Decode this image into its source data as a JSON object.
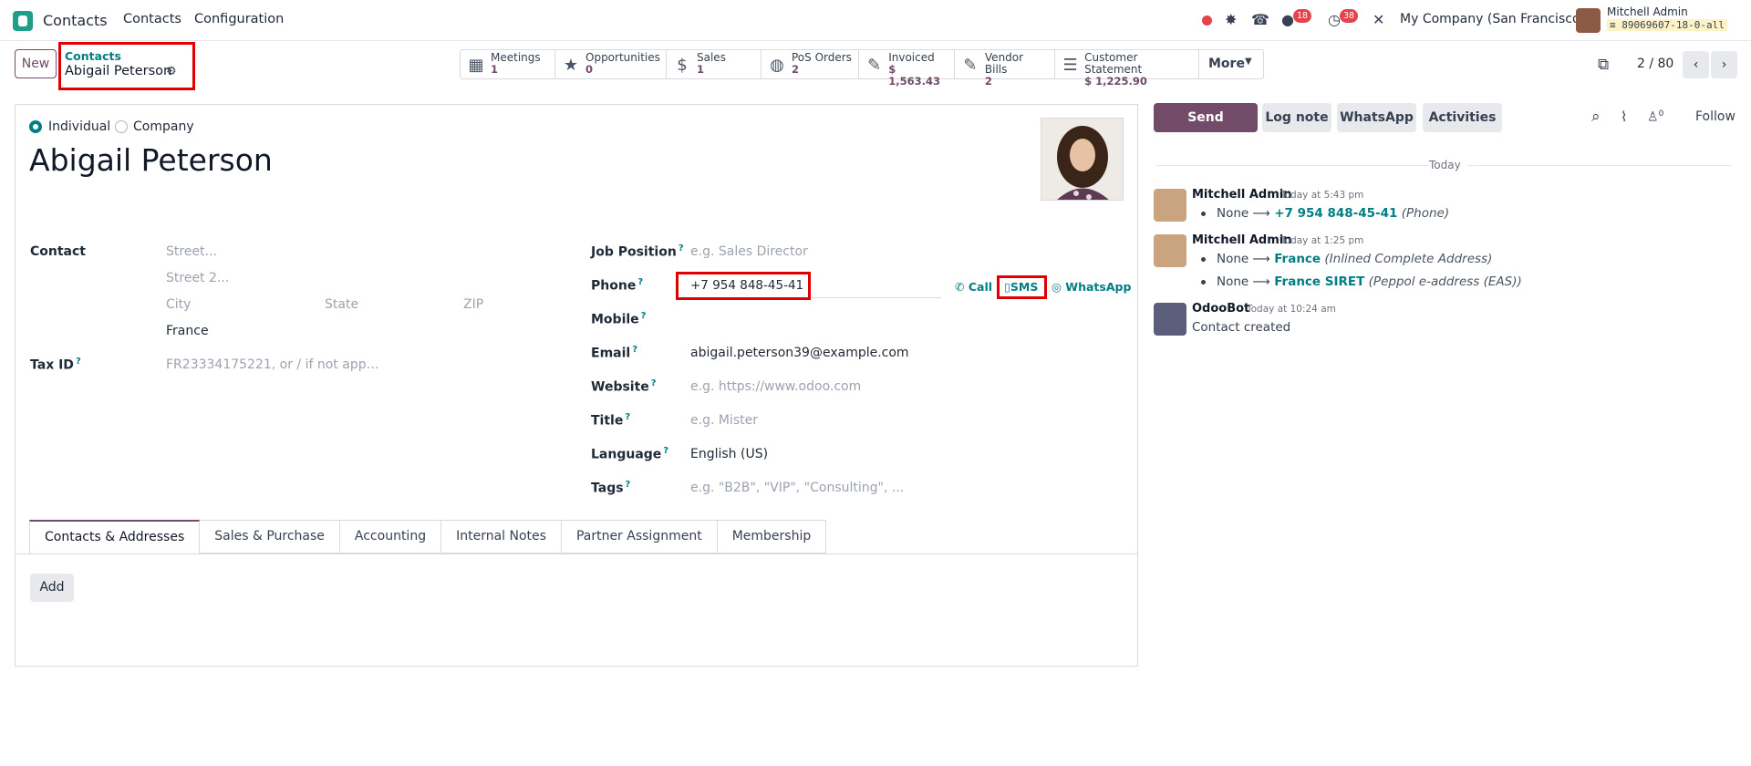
{
  "navbar": {
    "app_name": "Contacts",
    "menu": [
      "Contacts",
      "Configuration"
    ],
    "badges": {
      "messages": "18",
      "activities": "38"
    },
    "company": "My Company (San Francisco)",
    "user_name": "Mitchell Admin",
    "db_name": "89069607-18-0-all"
  },
  "control": {
    "new_label": "New",
    "breadcrumb_parent": "Contacts",
    "breadcrumb_current": "Abigail Peterson",
    "pager": "2 / 80",
    "smart_buttons": [
      {
        "label": "Meetings",
        "value": "1",
        "icon": "calendar-icon"
      },
      {
        "label": "Opportunities",
        "value": "0",
        "icon": "star-icon"
      },
      {
        "label": "Sales",
        "value": "1",
        "icon": "dollar-icon"
      },
      {
        "label": "PoS Orders",
        "value": "2",
        "icon": "shopping-bag-icon"
      },
      {
        "label": "Invoiced",
        "value": "$ 1,563.43",
        "icon": "pencil-square-icon"
      },
      {
        "label": "Vendor Bills",
        "value": "2",
        "icon": "pencil-square-icon"
      },
      {
        "label": "Customer Statement",
        "value": "$ 1,225.90",
        "icon": "list-icon"
      }
    ],
    "more_label": "More"
  },
  "form": {
    "type_individual": "Individual",
    "type_company": "Company",
    "name": "Abigail Peterson",
    "contact_label": "Contact",
    "street_ph": "Street...",
    "street2_ph": "Street 2...",
    "city_ph": "City",
    "state_ph": "State",
    "zip_ph": "ZIP",
    "country": "France",
    "taxid_label": "Tax ID",
    "taxid_ph": "FR23334175221, or / if not app…",
    "job_label": "Job Position",
    "job_ph": "e.g. Sales Director",
    "phone_label": "Phone",
    "phone_value": "+7 954 848-45-41",
    "call_label": "Call",
    "sms_label": "SMS",
    "whatsapp_label": "WhatsApp",
    "mobile_label": "Mobile",
    "email_label": "Email",
    "email_value": "abigail.peterson39@example.com",
    "website_label": "Website",
    "website_ph": "e.g. https://www.odoo.com",
    "title_label": "Title",
    "title_ph": "e.g. Mister",
    "language_label": "Language",
    "language_value": "English (US)",
    "tags_label": "Tags",
    "tags_ph": "e.g. \"B2B\", \"VIP\", \"Consulting\", ...",
    "tabs": [
      "Contacts & Addresses",
      "Sales & Purchase",
      "Accounting",
      "Internal Notes",
      "Partner Assignment",
      "Membership"
    ],
    "add_label": "Add"
  },
  "chatter": {
    "send_message": "Send message",
    "log_note": "Log note",
    "whatsapp": "WhatsApp",
    "activities": "Activities",
    "followers_count": "0",
    "follow": "Follow",
    "day": "Today",
    "messages": [
      {
        "author": "Mitchell Admin",
        "time": "Today at 5:43 pm",
        "lines": [
          {
            "old": "None",
            "new": "+7 954 848-45-41",
            "field": "(Phone)"
          }
        ]
      },
      {
        "author": "Mitchell Admin",
        "time": "Today at 1:25 pm",
        "lines": [
          {
            "old": "None",
            "new": "France",
            "field": "(Inlined Complete Address)"
          },
          {
            "old": "None",
            "new": "France SIRET",
            "field": "(Peppol e-address (EAS))"
          }
        ]
      },
      {
        "author": "OdooBot",
        "time": "Today at 10:24 am",
        "text": "Contact created"
      }
    ]
  },
  "colors": {
    "brand": "#714b67",
    "teal": "#017e84",
    "highlight": "#e00000"
  }
}
